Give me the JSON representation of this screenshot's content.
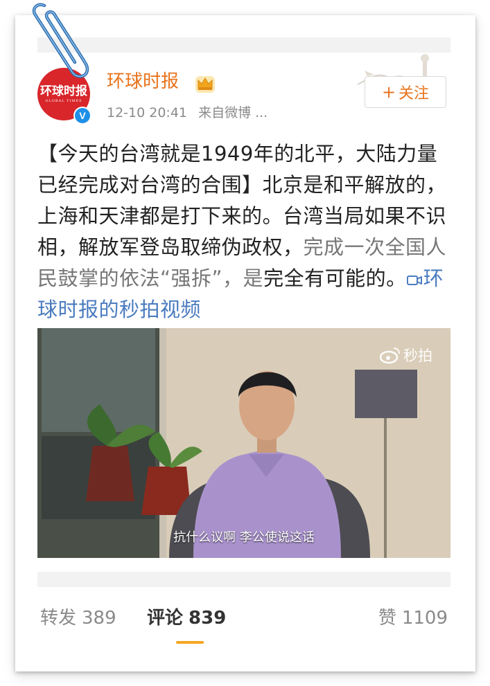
{
  "post": {
    "account_name": "环球时报",
    "avatar_text": "环球时报",
    "avatar_subtext": "GLOBAL TIMES",
    "verified_mark": "V",
    "timestamp": "12-10 20:41",
    "source": "来自微博 ...",
    "follow_label": "关注",
    "follow_plus": "+",
    "text_part1": "【今天的台湾就是1949年的北平，大陆力量已经完成对台湾的合围】北京是和平解放的，上海和天津都是打下来的。台湾当局如果不识相，解放军登岛取缔伪政权，",
    "text_part2": "完成一次全国人民鼓掌的依法“强拆”，是",
    "text_part3": "完全有可能的。",
    "video_link": "环球时报的秒拍视频"
  },
  "video": {
    "watermark": "秒拍",
    "subtitle": "抗什么议啊 李公使说这话"
  },
  "stats": {
    "repost_label": "转发",
    "repost_count": "389",
    "comment_label": "评论",
    "comment_count": "839",
    "like_label": "赞",
    "like_count": "1109"
  },
  "colors": {
    "accent_orange": "#e8731c",
    "link_blue": "#4a7bbf",
    "avatar_red": "#d8262b",
    "verified_blue": "#1e90e8",
    "tab_underline": "#f5a623"
  }
}
